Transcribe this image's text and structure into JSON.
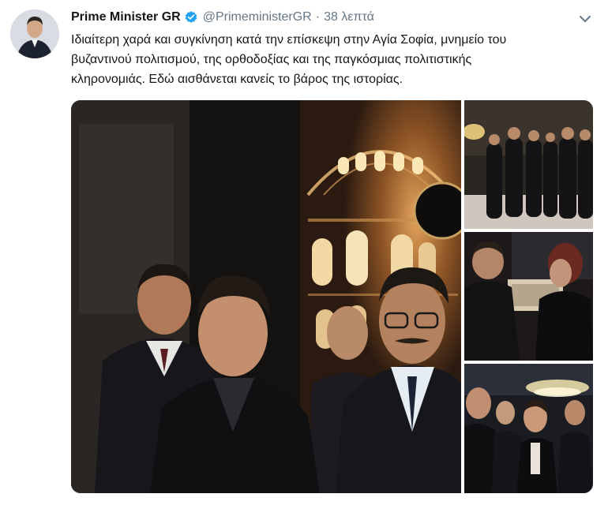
{
  "tweet": {
    "display_name": "Prime Minister GR",
    "handle": "@PrimeministerGR",
    "separator": "·",
    "timestamp": "38 λεπτά",
    "verified": true,
    "text_lines": [
      "Ιδιαίτερη χαρά και συγκίνηση κατά την επίσκεψη στην Αγία Σοφία, μνημείο του",
      "βυζαντινού πολιτισμού, της ορθοδοξίας και της παγκόσμιας πολιτιστικής",
      "κληρονομιάς. Εδώ αισθάνεται κανείς το βάρος της ιστορίας."
    ]
  },
  "icons": {
    "verified": "verified-badge-icon",
    "menu": "chevron-down-icon"
  },
  "colors": {
    "text": "#14171a",
    "secondary": "#657786",
    "verified": "#1da1f2"
  },
  "media": {
    "photo_count": 4
  }
}
